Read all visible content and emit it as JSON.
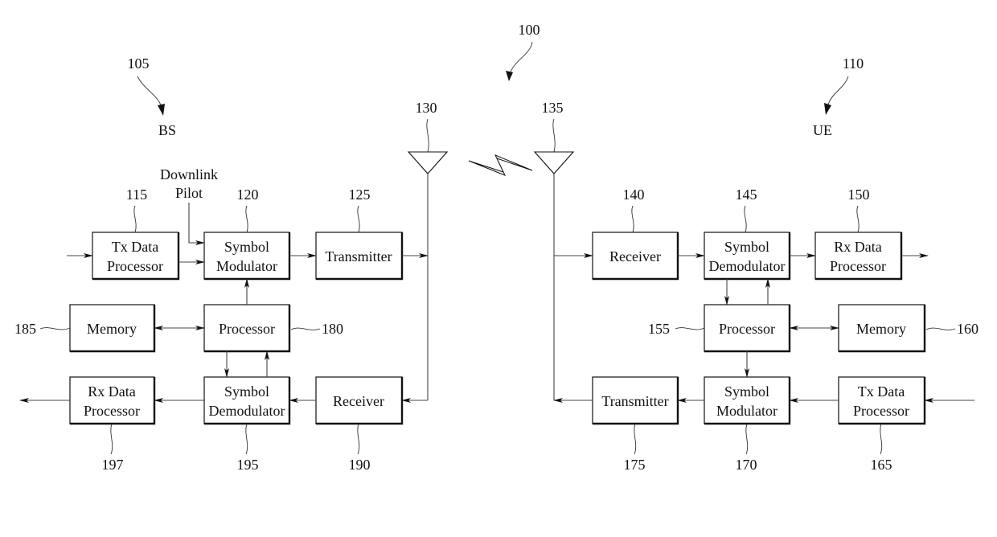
{
  "figure": {
    "reference": "100",
    "link_symbol": "lightning-bolt-icon"
  },
  "base_station": {
    "label": "BS",
    "ref": "105",
    "antenna_ref": "130",
    "downlink_pilot_label": [
      "Downlink",
      "Pilot"
    ],
    "blocks": {
      "tx_data_processor": {
        "lines": [
          "Tx Data",
          "Processor"
        ],
        "ref": "115"
      },
      "symbol_modulator": {
        "lines": [
          "Symbol",
          "Modulator"
        ],
        "ref": "120"
      },
      "transmitter": {
        "lines": [
          "Transmitter"
        ],
        "ref": "125"
      },
      "memory": {
        "lines": [
          "Memory"
        ],
        "ref": "185"
      },
      "processor": {
        "lines": [
          "Processor"
        ],
        "ref": "180"
      },
      "rx_data_processor": {
        "lines": [
          "Rx Data",
          "Processor"
        ],
        "ref": "197"
      },
      "symbol_demodulator": {
        "lines": [
          "Symbol",
          "Demodulator"
        ],
        "ref": "195"
      },
      "receiver": {
        "lines": [
          "Receiver"
        ],
        "ref": "190"
      }
    }
  },
  "user_equipment": {
    "label": "UE",
    "ref": "110",
    "antenna_ref": "135",
    "blocks": {
      "receiver": {
        "lines": [
          "Receiver"
        ],
        "ref": "140"
      },
      "symbol_demodulator": {
        "lines": [
          "Symbol",
          "Demodulator"
        ],
        "ref": "145"
      },
      "rx_data_processor": {
        "lines": [
          "Rx Data",
          "Processor"
        ],
        "ref": "150"
      },
      "processor": {
        "lines": [
          "Processor"
        ],
        "ref": "155"
      },
      "memory": {
        "lines": [
          "Memory"
        ],
        "ref": "160"
      },
      "transmitter": {
        "lines": [
          "Transmitter"
        ],
        "ref": "175"
      },
      "symbol_modulator": {
        "lines": [
          "Symbol",
          "Modulator"
        ],
        "ref": "170"
      },
      "tx_data_processor": {
        "lines": [
          "Tx Data",
          "Processor"
        ],
        "ref": "165"
      }
    }
  }
}
